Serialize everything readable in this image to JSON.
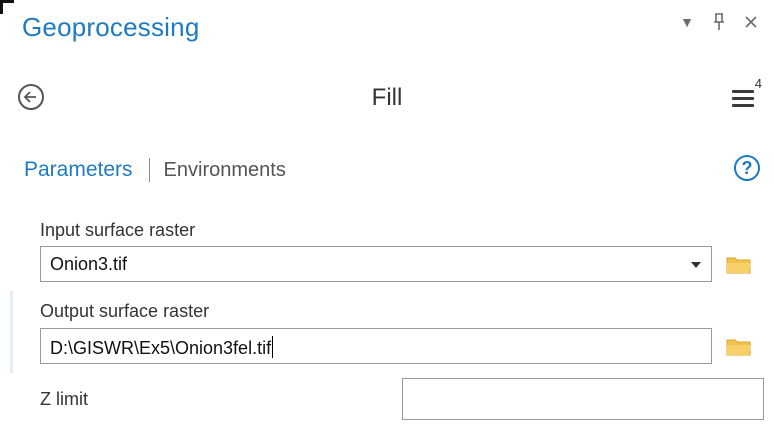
{
  "header": {
    "title": "Geoprocessing",
    "controls": {
      "dropdown_glyph": "▾",
      "pin_glyph": "ᵖ",
      "close_glyph": "×"
    }
  },
  "tool": {
    "name": "Fill",
    "menu_badge": "4"
  },
  "tabs": {
    "parameters": "Parameters",
    "environments": "Environments",
    "help_glyph": "?"
  },
  "parameters": {
    "input_surface": {
      "label": "Input surface raster",
      "value": "Onion3.tif"
    },
    "output_surface": {
      "label": "Output surface raster",
      "value": "D:\\GISWR\\Ex5\\Onion3fel.tif"
    },
    "z_limit": {
      "label": "Z limit",
      "value": ""
    }
  },
  "icons": {
    "back": "back-arrow-circle-icon",
    "menu": "hamburger-menu-icon",
    "help": "help-circle-icon",
    "browse": "folder-icon",
    "dropdown": "chevron-down-icon"
  },
  "colors": {
    "accent": "#1e7bc2",
    "folder": "#f2c24e",
    "border": "#9a9a9a"
  }
}
